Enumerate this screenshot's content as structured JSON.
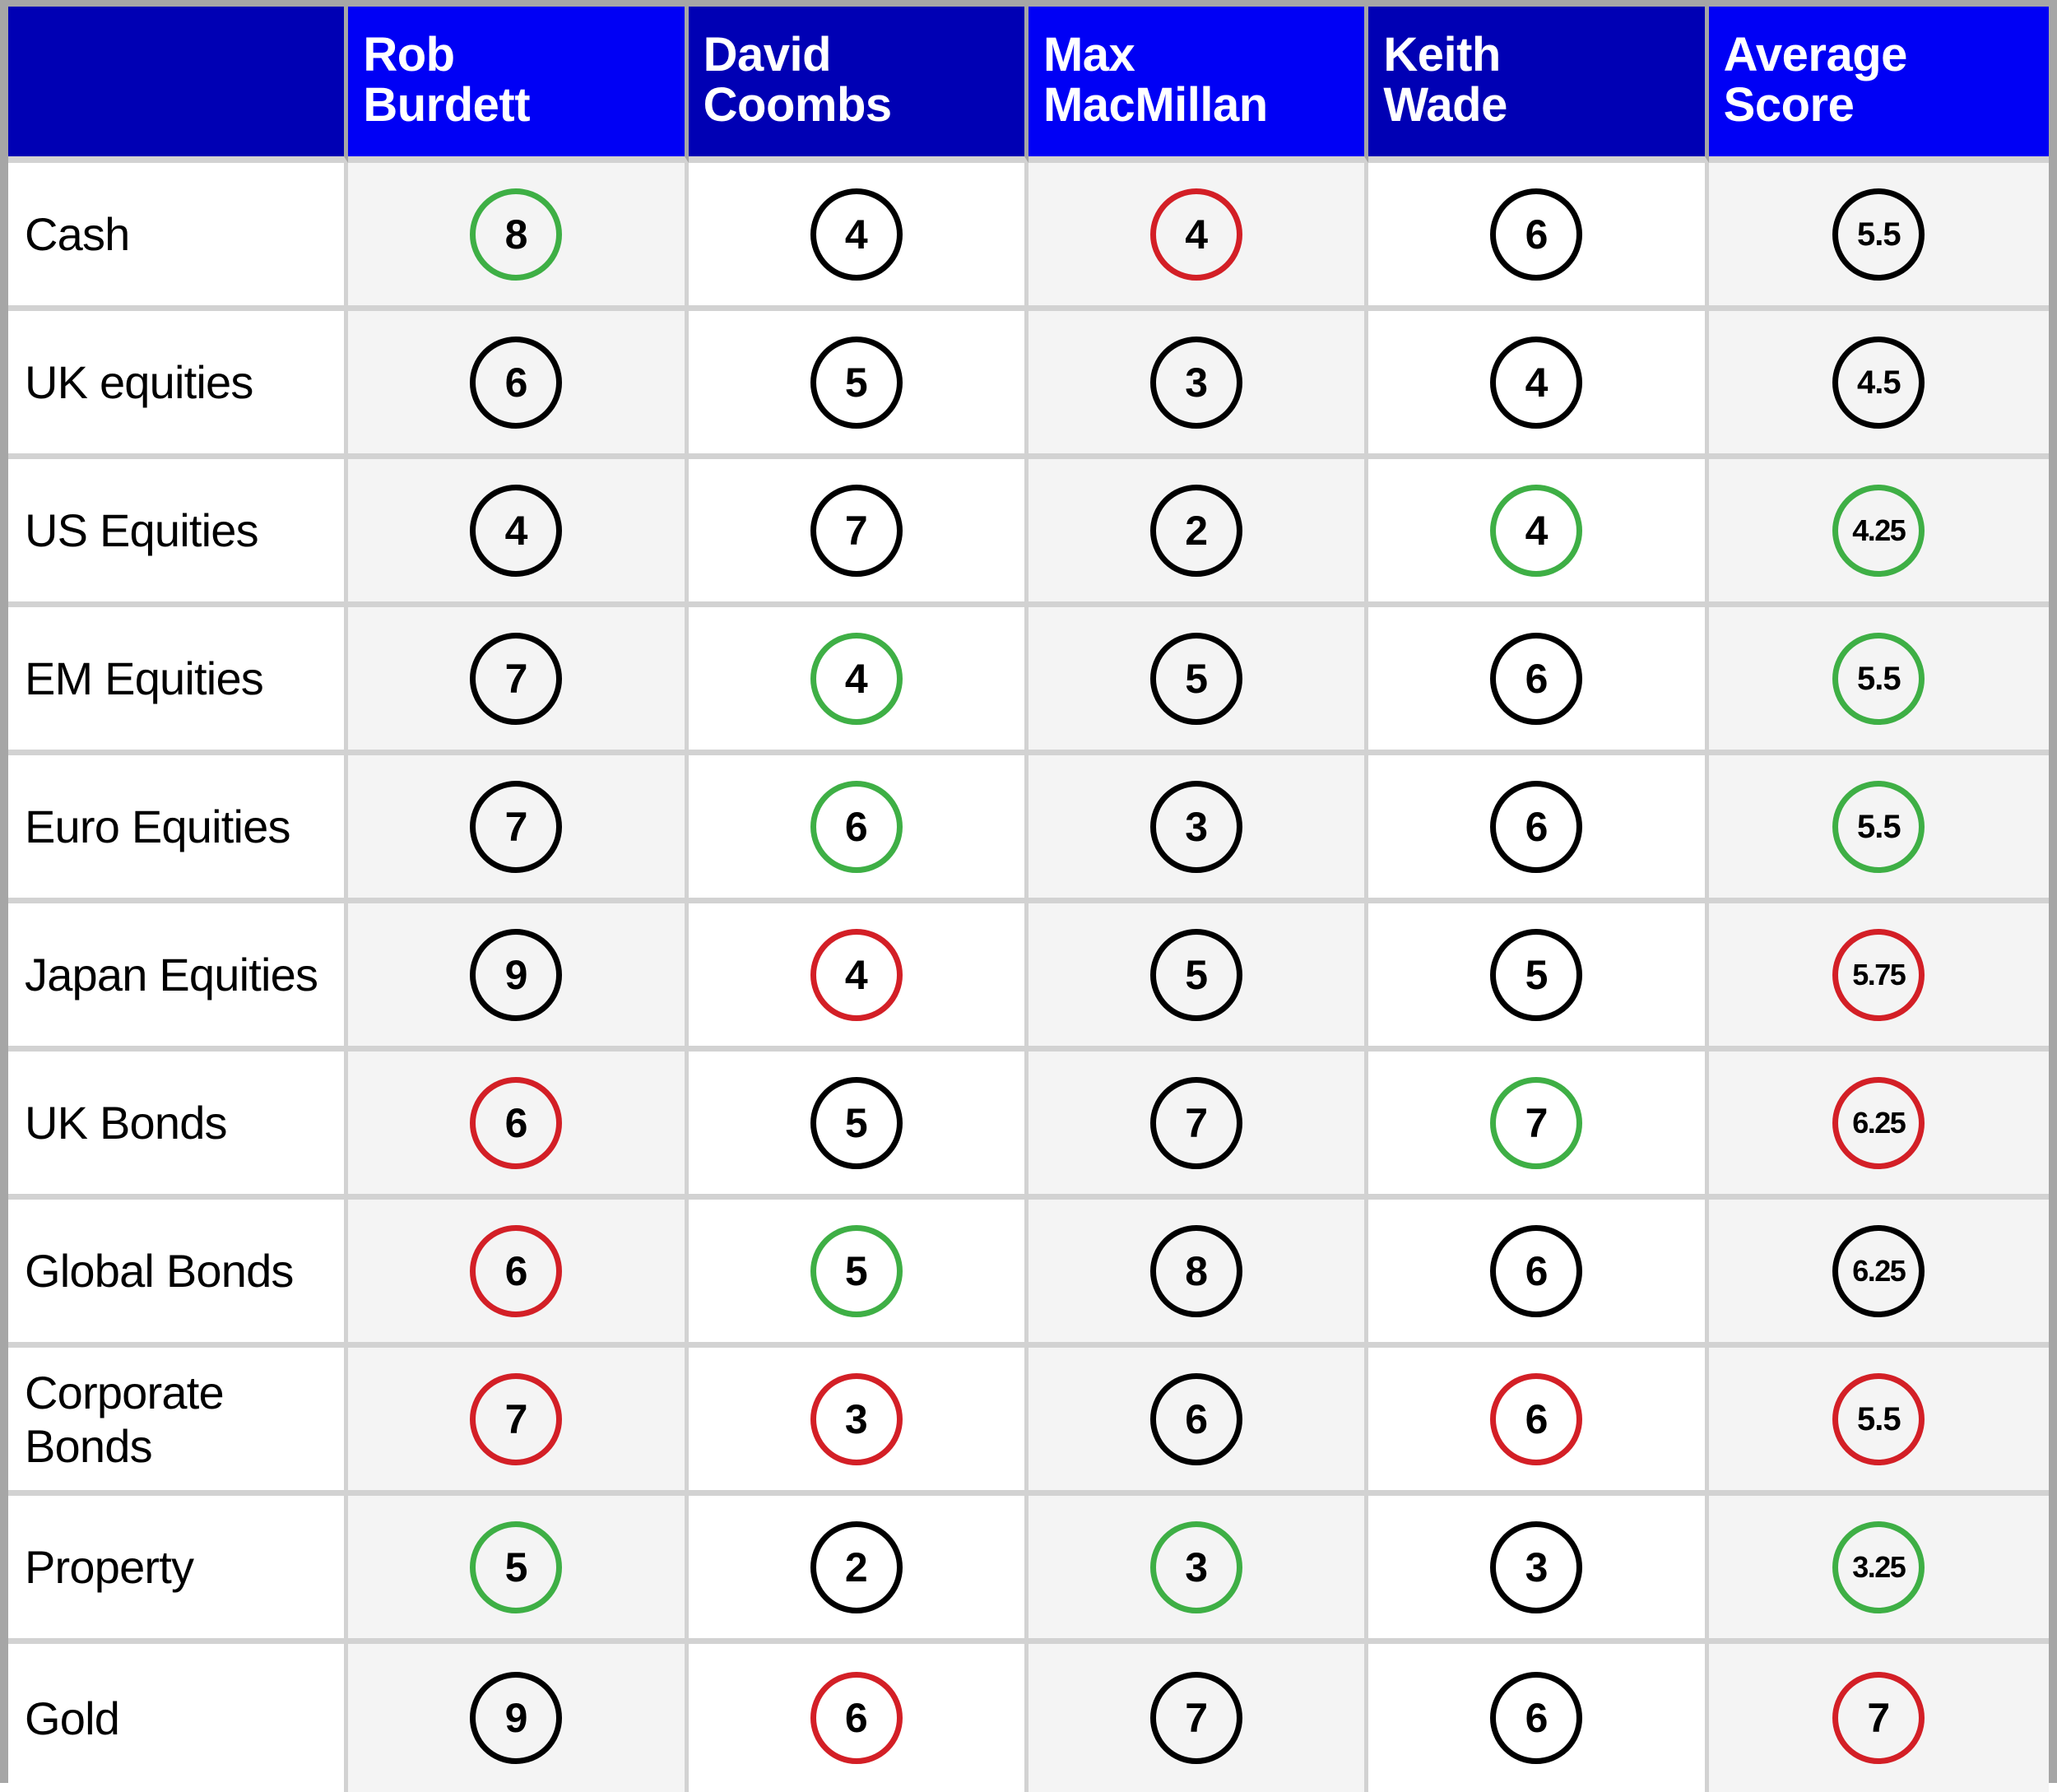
{
  "table": {
    "corner_header": "",
    "columns": [
      {
        "label": "Rob\nBurdett",
        "key": "rob_burdett",
        "header_style": "light"
      },
      {
        "label": "David\nCoombs",
        "key": "david_coombs",
        "header_style": "dark"
      },
      {
        "label": "Max\nMacMillan",
        "key": "max_macmillan",
        "header_style": "light"
      },
      {
        "label": "Keith\nWade",
        "key": "keith_wade",
        "header_style": "dark"
      },
      {
        "label": "Average\nScore",
        "key": "average_score",
        "header_style": "light"
      }
    ],
    "rows": [
      {
        "label": "Cash",
        "cells": [
          {
            "value": "8",
            "color": "green"
          },
          {
            "value": "4",
            "color": "black"
          },
          {
            "value": "4",
            "color": "red"
          },
          {
            "value": "6",
            "color": "black"
          },
          {
            "value": "5.5",
            "color": "black"
          }
        ]
      },
      {
        "label": "UK equities",
        "cells": [
          {
            "value": "6",
            "color": "black"
          },
          {
            "value": "5",
            "color": "black"
          },
          {
            "value": "3",
            "color": "black"
          },
          {
            "value": "4",
            "color": "black"
          },
          {
            "value": "4.5",
            "color": "black"
          }
        ]
      },
      {
        "label": "US Equities",
        "cells": [
          {
            "value": "4",
            "color": "black"
          },
          {
            "value": "7",
            "color": "black"
          },
          {
            "value": "2",
            "color": "black"
          },
          {
            "value": "4",
            "color": "green"
          },
          {
            "value": "4.25",
            "color": "green"
          }
        ]
      },
      {
        "label": "EM Equities",
        "cells": [
          {
            "value": "7",
            "color": "black"
          },
          {
            "value": "4",
            "color": "green"
          },
          {
            "value": "5",
            "color": "black"
          },
          {
            "value": "6",
            "color": "black"
          },
          {
            "value": "5.5",
            "color": "green"
          }
        ]
      },
      {
        "label": "Euro Equities",
        "cells": [
          {
            "value": "7",
            "color": "black"
          },
          {
            "value": "6",
            "color": "green"
          },
          {
            "value": "3",
            "color": "black"
          },
          {
            "value": "6",
            "color": "black"
          },
          {
            "value": "5.5",
            "color": "green"
          }
        ]
      },
      {
        "label": "Japan Equities",
        "cells": [
          {
            "value": "9",
            "color": "black"
          },
          {
            "value": "4",
            "color": "red"
          },
          {
            "value": "5",
            "color": "black"
          },
          {
            "value": "5",
            "color": "black"
          },
          {
            "value": "5.75",
            "color": "red"
          }
        ]
      },
      {
        "label": "UK Bonds",
        "cells": [
          {
            "value": "6",
            "color": "red"
          },
          {
            "value": "5",
            "color": "black"
          },
          {
            "value": "7",
            "color": "black"
          },
          {
            "value": "7",
            "color": "green"
          },
          {
            "value": "6.25",
            "color": "red"
          }
        ]
      },
      {
        "label": "Global Bonds",
        "cells": [
          {
            "value": "6",
            "color": "red"
          },
          {
            "value": "5",
            "color": "green"
          },
          {
            "value": "8",
            "color": "black"
          },
          {
            "value": "6",
            "color": "black"
          },
          {
            "value": "6.25",
            "color": "black"
          }
        ]
      },
      {
        "label": "Corporate Bonds",
        "cells": [
          {
            "value": "7",
            "color": "red"
          },
          {
            "value": "3",
            "color": "red"
          },
          {
            "value": "6",
            "color": "black"
          },
          {
            "value": "6",
            "color": "red"
          },
          {
            "value": "5.5",
            "color": "red"
          }
        ]
      },
      {
        "label": "Property",
        "cells": [
          {
            "value": "5",
            "color": "green"
          },
          {
            "value": "2",
            "color": "black"
          },
          {
            "value": "3",
            "color": "green"
          },
          {
            "value": "3",
            "color": "black"
          },
          {
            "value": "3.25",
            "color": "green"
          }
        ]
      },
      {
        "label": "Gold",
        "cells": [
          {
            "value": "9",
            "color": "black"
          },
          {
            "value": "6",
            "color": "red"
          },
          {
            "value": "7",
            "color": "black"
          },
          {
            "value": "6",
            "color": "black"
          },
          {
            "value": "7",
            "color": "red"
          }
        ]
      }
    ]
  },
  "colors": {
    "header_dark_blue": "#0000b4",
    "header_light_blue": "#0000f5",
    "circle_green": "#3eaf45",
    "circle_red": "#d31f26",
    "circle_black": "#000000",
    "band_gray": "#f4f4f4",
    "grid_line": "#d2d2d2",
    "outer_frame": "#a6a6a6"
  }
}
